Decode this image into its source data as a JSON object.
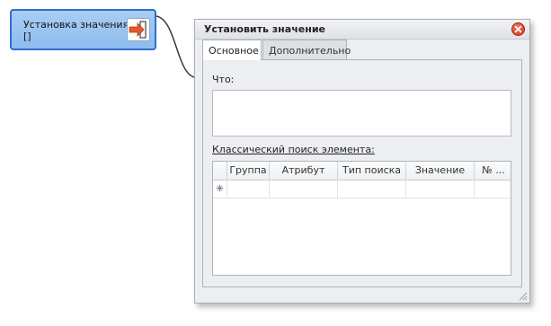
{
  "node": {
    "label": "Установка значения",
    "value": "[]",
    "icon": "set-value-icon",
    "border_color": "#2f6fd0",
    "arrow_color": "#e55a2b"
  },
  "dialog": {
    "title": "Установить значение",
    "close_icon": "close-icon",
    "tabs": [
      {
        "label": "Основное",
        "active": true
      },
      {
        "label": "Дополнительно",
        "active": false
      }
    ],
    "what_label": "Что:",
    "what_value": "",
    "search_label": "Классический поиск элемента:",
    "grid": {
      "columns": [
        "Группа",
        "Атрибут",
        "Тип поиска",
        "Значение",
        "№ ..."
      ],
      "new_row_icon": "new-row-asterisk-icon",
      "rows": []
    }
  }
}
